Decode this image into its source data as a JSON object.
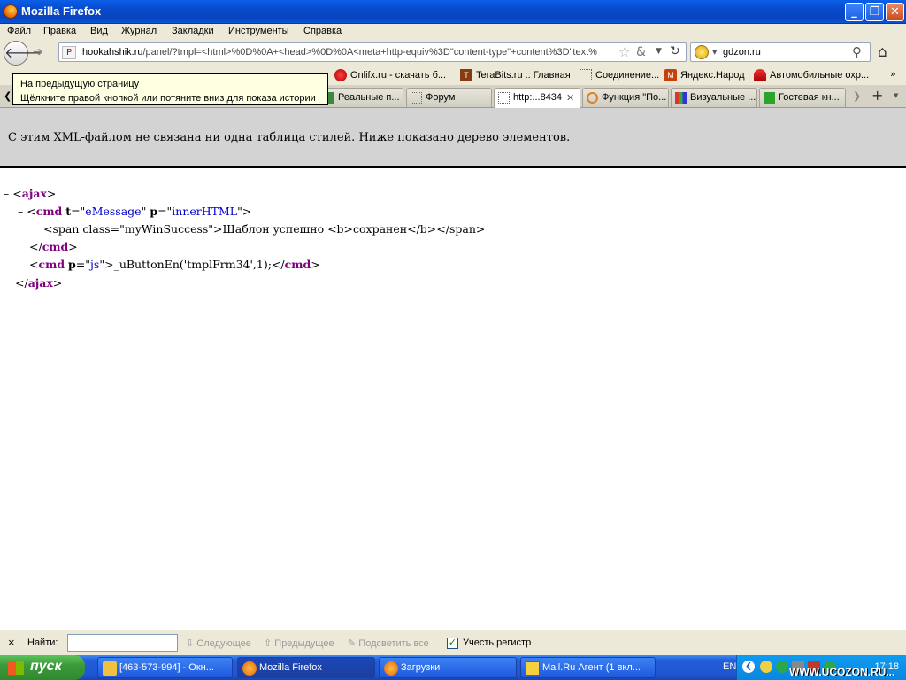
{
  "window": {
    "title": "Mozilla Firefox"
  },
  "menu": [
    "Файл",
    "Правка",
    "Вид",
    "Журнал",
    "Закладки",
    "Инструменты",
    "Справка"
  ],
  "nav": {
    "url_domain": "hookahshik.ru",
    "url_path": "/panel/?tmpl=<html>%0D%0A+<head>%0D%0A<meta+http-equiv%3D\"content-type\"+content%3D\"text%",
    "search_value": "gdzon.ru"
  },
  "bookmarks": [
    "Onlifx.ru - скачать б...",
    "TeraBits.ru :: Главная",
    "Соединение...",
    "Яндекс.Народ",
    "Автомобильные охр..."
  ],
  "tooltip": {
    "line1": "На предыдущую страницу",
    "line2": "Щёлкните правой кнопкой или потяните вниз для показа истории"
  },
  "tabs": [
    {
      "label": "Реальные п...",
      "active": false
    },
    {
      "label": "Форум",
      "active": false
    },
    {
      "label": "http:...8434",
      "active": true
    },
    {
      "label": "Функция \"По...",
      "active": false
    },
    {
      "label": "Визуальные ...",
      "active": false
    },
    {
      "label": "Гостевая кн...",
      "active": false
    }
  ],
  "xml_notice": "С этим XML-файлом не связана ни одна таблица стилей. Ниже показано дерево элементов.",
  "xml": {
    "toggle": "–",
    "lt": "<",
    "gt": ">",
    "close_lt": "</",
    "eq_q": "=\"",
    "q_sp": "\" ",
    "q": "\"",
    "root_tag": "ajax",
    "cmd_tag": "cmd",
    "attr_t": "t",
    "attr_t_val": "eMessage",
    "attr_p": "p",
    "attr_p_val": "innerHTML",
    "cmd1_text": "<span class=\"myWinSuccess\">Шаблон успешно <b>сохранен</b></span>",
    "cmd2_p_val": "js",
    "cmd2_text": "_uButtonEn('tmplFrm34',1);"
  },
  "findbar": {
    "close": "×",
    "label": "Найти:",
    "next": "Следующее",
    "prev": "Предыдущее",
    "highlight": "Подсветить все",
    "match_case": "Учесть регистр"
  },
  "taskbar": {
    "start": "пуск",
    "tasks": [
      {
        "label": "[463-573-994] - Окн...",
        "active": false
      },
      {
        "label": "Mozilla Firefox",
        "active": true
      },
      {
        "label": "Загрузки",
        "active": false
      },
      {
        "label": "Mail.Ru Агент (1 вкл...",
        "active": false
      }
    ],
    "lang": "EN",
    "clock": "17:18"
  },
  "watermark": "WWW.UCOZON.RU..."
}
